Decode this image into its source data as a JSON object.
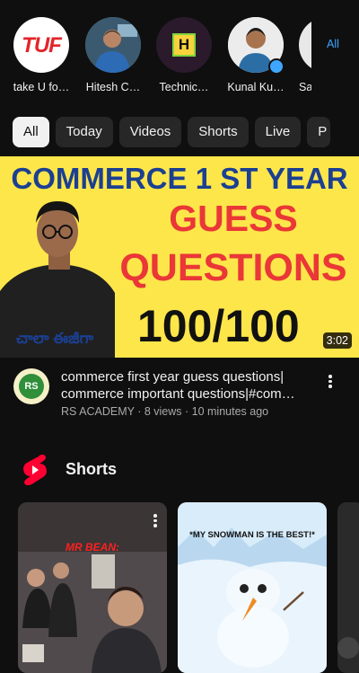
{
  "channels": [
    {
      "label": "take U fo…",
      "logo_text": "TUF"
    },
    {
      "label": "Hitesh C…"
    },
    {
      "label": "Technic…",
      "logo_text": "H"
    },
    {
      "label": "Kunal Ku…"
    },
    {
      "label": "Sa"
    }
  ],
  "all_link": "All",
  "chips": [
    "All",
    "Today",
    "Videos",
    "Shorts",
    "Live",
    "P"
  ],
  "video": {
    "thumb_line1": "COMMERCE 1 ST YEAR",
    "thumb_guess": "GUESS",
    "thumb_questions": "QUESTIONS",
    "thumb_score": "100/100",
    "thumb_telugu": "చాలా ఈజీగా",
    "duration": "3:02",
    "channel_avatar_text": "RS",
    "title_line1": "commerce first year guess questions|",
    "title_line2": "commerce important questions|#com…",
    "meta": "RS ACADEMY · 8 views · 10 minutes ago"
  },
  "shorts": {
    "section_title": "Shorts",
    "cards": [
      {
        "caption": "MR BEAN:"
      },
      {
        "caption": "*MY SNOWMAN IS THE BEST!*"
      }
    ]
  },
  "colors": {
    "bg": "#0f0f0f",
    "chip": "#272727",
    "accent_blue": "#3ea6ff",
    "youtube_red": "#ff0033"
  }
}
